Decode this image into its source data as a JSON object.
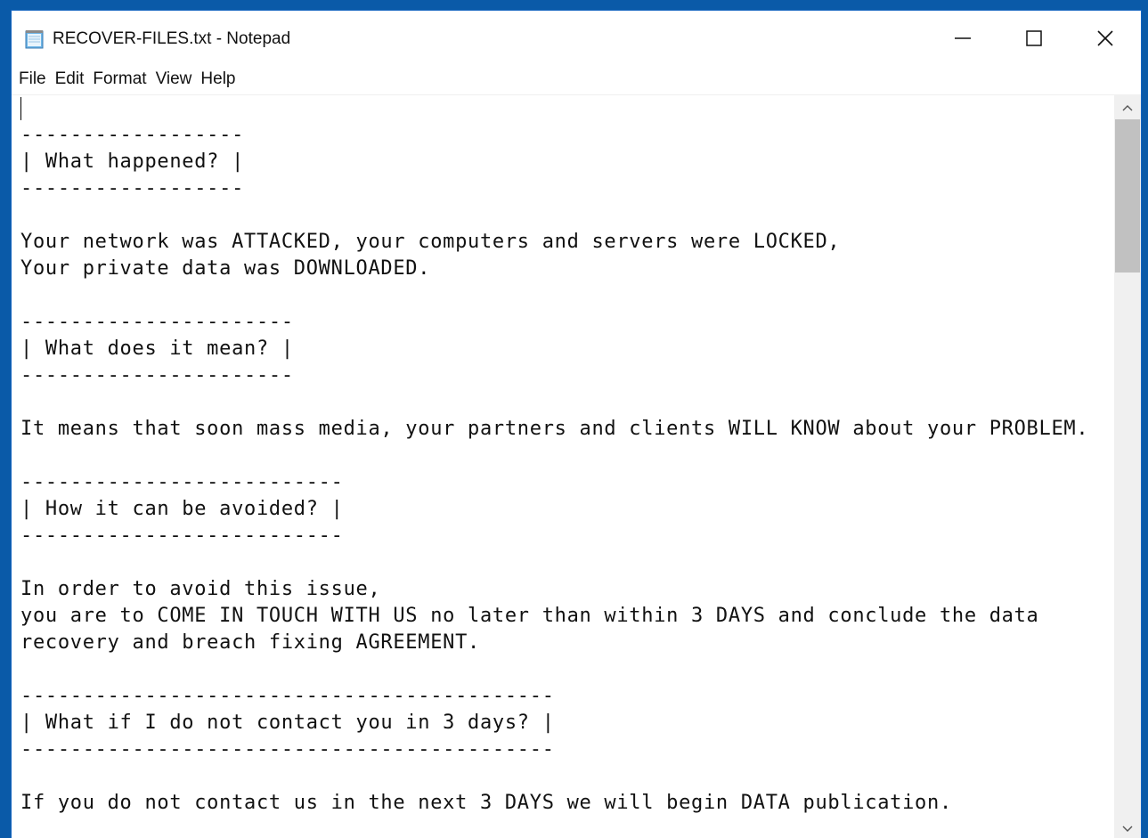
{
  "window": {
    "title": "RECOVER-FILES.txt - Notepad"
  },
  "menu": [
    "File",
    "Edit",
    "Format",
    "View",
    "Help"
  ],
  "icons": {
    "app": "notepad-icon",
    "minimize": "minimize-icon",
    "maximize": "maximize-icon",
    "close": "close-icon",
    "scroll_up": "chevron-up-icon",
    "scroll_down": "chevron-down-icon"
  },
  "colors": {
    "desktop": "#0a5aa8",
    "scroll_thumb": "#c1c1c1"
  },
  "scroll": {
    "thumb_fraction": 0.22
  },
  "content": {
    "lines": [
      "",
      "------------------",
      "| What happened? |",
      "------------------",
      "",
      "Your network was ATTACKED, your computers and servers were LOCKED,",
      "Your private data was DOWNLOADED.",
      "",
      "----------------------",
      "| What does it mean? |",
      "----------------------",
      "",
      "It means that soon mass media, your partners and clients WILL KNOW about your PROBLEM.",
      "",
      "--------------------------",
      "| How it can be avoided? |",
      "--------------------------",
      "",
      "In order to avoid this issue,",
      "you are to COME IN TOUCH WITH US no later than within 3 DAYS and conclude the data",
      "recovery and breach fixing AGREEMENT.",
      "",
      "-------------------------------------------",
      "| What if I do not contact you in 3 days? |",
      "-------------------------------------------",
      "",
      "If you do not contact us in the next 3 DAYS we will begin DATA publication."
    ]
  }
}
